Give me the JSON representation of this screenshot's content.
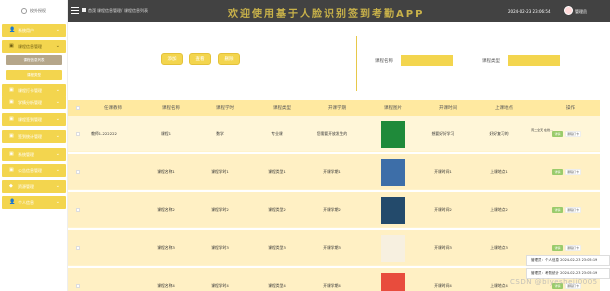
{
  "sidebar": {
    "logo_text": "校外授权",
    "items": [
      {
        "label": "系统用户",
        "icon": "👤",
        "open": false
      },
      {
        "label": "课程信息管理",
        "icon": "▣",
        "open": true
      },
      {
        "label": "课程打卡管理",
        "icon": "▣",
        "open": false
      },
      {
        "label": "学情分析管理",
        "icon": "▣",
        "open": false
      },
      {
        "label": "课程签到管理",
        "icon": "▣",
        "open": false
      },
      {
        "label": "签到统计管理",
        "icon": "▣",
        "open": false
      },
      {
        "label": "系统管理",
        "icon": "▣",
        "open": false
      },
      {
        "label": "公告信息管理",
        "icon": "▣",
        "open": false
      },
      {
        "label": "资源管理",
        "icon": "◆",
        "open": false
      },
      {
        "label": "个人信息",
        "icon": "👤",
        "open": false
      }
    ],
    "sub_items": [
      {
        "label": "课程信息列表",
        "active": true
      },
      {
        "label": "课程类型",
        "active": false
      }
    ]
  },
  "header": {
    "breadcrumb_1": "首页",
    "breadcrumb_2": "课程信息管理",
    "breadcrumb_3": "课程信息列表",
    "system_title": "欢迎使用基于人脸识别签到考勤APP",
    "datetime": "2024-02-23 23:06:54",
    "username": "管理员"
  },
  "toolbar": {
    "buttons": [
      "添加",
      "查看",
      "删除"
    ]
  },
  "search": {
    "course_name_label": "课程名称",
    "course_type_label": "课程类型",
    "course_name_value": "",
    "course_type_value": ""
  },
  "table": {
    "headers": [
      "任课教师",
      "课程名称",
      "课程学时",
      "课程类型",
      "开课学期",
      "课程图片",
      "开课时间",
      "上课地点",
      "操作"
    ],
    "rows": [
      {
        "teacher": "教师1-222222",
        "name": "课程1",
        "hours": "数学",
        "type": "专业课",
        "semester": "您需要开放发生的",
        "pic": "green",
        "time": "想要好好学习",
        "place": "好好复习的",
        "extra": "周二全天 在线..."
      },
      {
        "teacher": "",
        "name": "课程名称1",
        "hours": "课程学时1",
        "type": "课程类型1",
        "semester": "开课学期1",
        "pic": "blue",
        "time": "开课时间1",
        "place": "上课地点1",
        "extra": ""
      },
      {
        "teacher": "",
        "name": "课程名称2",
        "hours": "课程学时2",
        "type": "课程类型2",
        "semester": "开课学期2",
        "pic": "book",
        "time": "开课时间2",
        "place": "上课地点2",
        "extra": ""
      },
      {
        "teacher": "",
        "name": "课程名称3",
        "hours": "课程学时3",
        "type": "课程类型3",
        "semester": "开课学期3",
        "pic": "wenxue",
        "time": "开课时间3",
        "place": "上课地点3",
        "extra": ""
      },
      {
        "teacher": "",
        "name": "课程名称4",
        "hours": "课程学时4",
        "type": "课程类型4",
        "semester": "开课学期4",
        "pic": "yuwen",
        "time": "开课时间4",
        "place": "上课地点4",
        "extra": ""
      }
    ],
    "op_detail": "详情",
    "op_other": "课程打卡"
  },
  "toasts": [
    "管理员：个人信息 2024-02-23 23:05:19",
    "管理员：考勤统计 2024-02-23 23:05:19"
  ],
  "watermark": "CSDN @biyesheji0005",
  "colors": {
    "accent": "#f3d54e",
    "header_bg": "#424242",
    "table_header": "#ffe9a0"
  }
}
